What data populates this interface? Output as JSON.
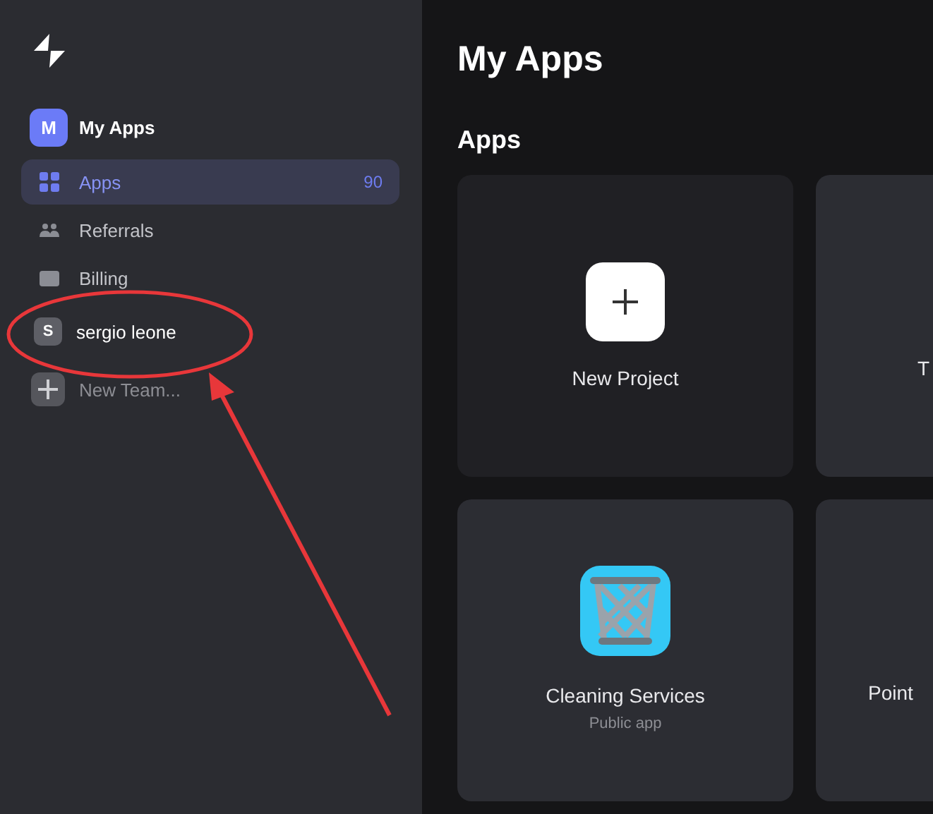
{
  "sidebar": {
    "workspace": {
      "avatar": "M",
      "name": "My Apps"
    },
    "items": [
      {
        "kind": "apps",
        "label": "Apps",
        "count": "90",
        "selected": true
      },
      {
        "kind": "referrals",
        "label": "Referrals",
        "selected": false
      },
      {
        "kind": "billing",
        "label": "Billing",
        "selected": false
      }
    ],
    "teams": [
      {
        "kind": "team",
        "avatar": "S",
        "label": "sergio leone"
      },
      {
        "kind": "new",
        "label": "New Team..."
      }
    ]
  },
  "main": {
    "title": "My Apps",
    "section": "Apps",
    "rows": [
      [
        {
          "kind": "new",
          "title": "New Project"
        },
        {
          "kind": "partial",
          "title": "T"
        }
      ],
      [
        {
          "kind": "app",
          "title": "Cleaning Services",
          "subtitle": "Public app"
        },
        {
          "kind": "partial",
          "title": "Point"
        }
      ]
    ]
  }
}
